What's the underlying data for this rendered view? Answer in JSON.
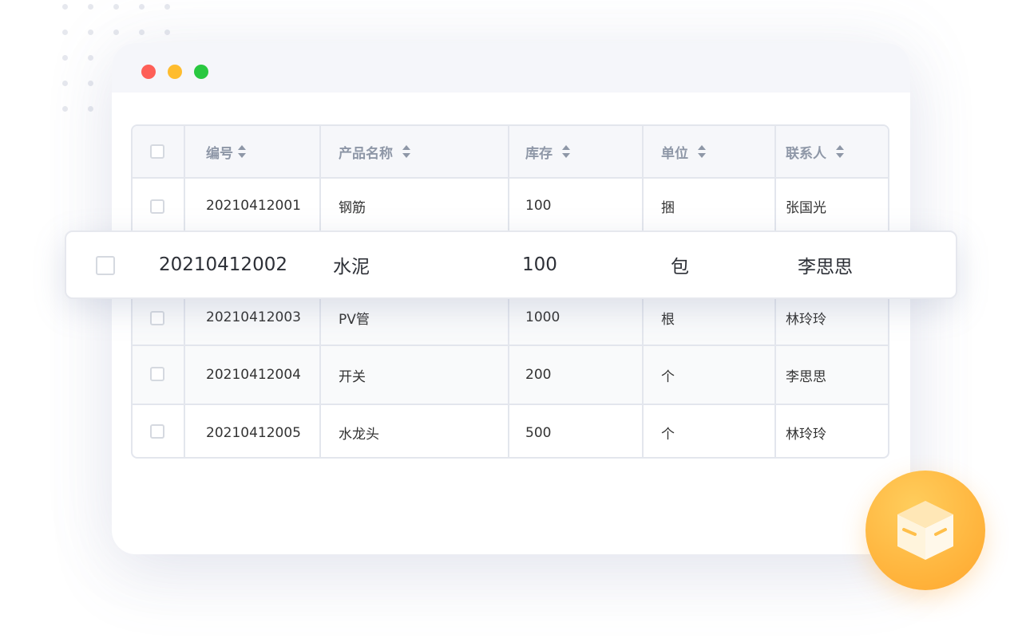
{
  "window": {
    "traffic_lights": [
      {
        "name": "close",
        "color": "#fe5f57"
      },
      {
        "name": "minimize",
        "color": "#febc2e"
      },
      {
        "name": "zoom",
        "color": "#29c840"
      }
    ]
  },
  "table": {
    "columns": [
      {
        "key": "id",
        "label": "编号"
      },
      {
        "key": "name",
        "label": "产品名称"
      },
      {
        "key": "stock",
        "label": "库存"
      },
      {
        "key": "unit",
        "label": "单位"
      },
      {
        "key": "contact",
        "label": "联系人"
      }
    ],
    "rows": [
      {
        "id": "20210412001",
        "name": "钢筋",
        "stock": "100",
        "unit": "捆",
        "contact": "张国光",
        "checked": false
      },
      {
        "id": "20210412002",
        "name": "水泥",
        "stock": "100",
        "unit": "包",
        "contact": "李思思",
        "checked": false
      },
      {
        "id": "20210412003",
        "name": "PV管",
        "stock": "1000",
        "unit": "根",
        "contact": "林玲玲",
        "checked": false
      },
      {
        "id": "20210412004",
        "name": "开关",
        "stock": "200",
        "unit": "个",
        "contact": "李思思",
        "checked": false
      },
      {
        "id": "20210412005",
        "name": "水龙头",
        "stock": "500",
        "unit": "个",
        "contact": "林玲玲",
        "checked": false
      }
    ]
  },
  "floating_row": {
    "id": "20210412002",
    "name": "水泥",
    "stock": "100",
    "unit": "包",
    "contact": "李思思",
    "checked": false
  },
  "badge": {
    "icon": "box-icon",
    "color": "#ffb23a"
  }
}
